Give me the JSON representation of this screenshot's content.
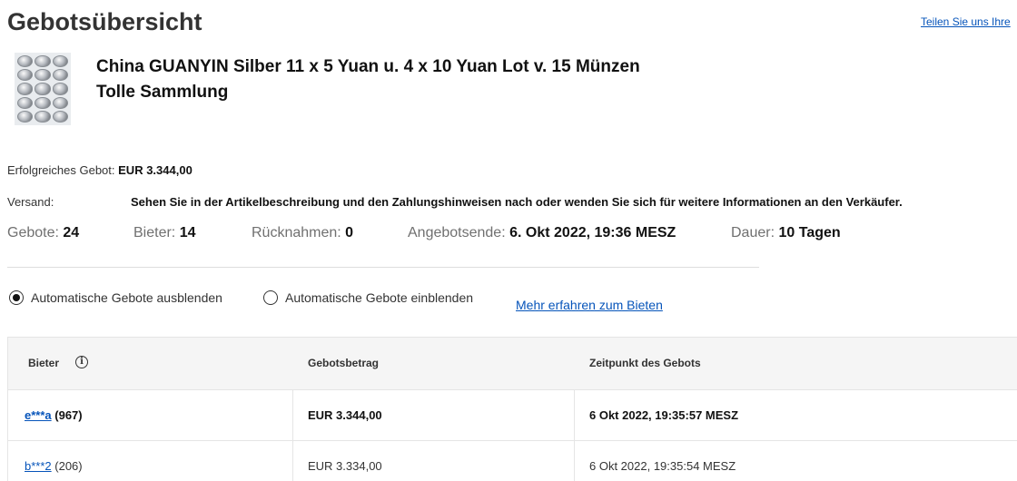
{
  "page": {
    "title": "Gebotsübersicht",
    "share_link": "Teilen Sie uns Ihre"
  },
  "item": {
    "title": "China GUANYIN Silber 11 x 5 Yuan u. 4 x 10 Yuan Lot v. 15 Münzen Tolle Sammlung"
  },
  "details": {
    "winning_bid_label": "Erfolgreiches Gebot:",
    "winning_bid_value": "EUR 3.344,00",
    "shipping_label": "Versand:",
    "shipping_value": "Sehen Sie in der Artikelbeschreibung und den Zahlungshinweisen nach oder wenden Sie sich für weitere Informationen an den Verkäufer."
  },
  "stats": {
    "bids_label": "Gebote:",
    "bids_value": "24",
    "bidders_label": "Bieter:",
    "bidders_value": "14",
    "retractions_label": "Rücknahmen:",
    "retractions_value": "0",
    "end_label": "Angebotsende:",
    "end_value": "6. Okt 2022, 19:36 MESZ",
    "duration_label": "Dauer:",
    "duration_value": "10 Tagen"
  },
  "options": {
    "hide_auto_label": "Automatische Gebote ausblenden",
    "hide_auto_selected": true,
    "show_auto_label": "Automatische Gebote einblenden",
    "show_auto_selected": false,
    "learn_more": "Mehr erfahren zum Bieten"
  },
  "table": {
    "headers": {
      "bidder": "Bieter",
      "amount": "Gebotsbetrag",
      "time": "Zeitpunkt des Gebots"
    },
    "rows": [
      {
        "bidder": "e***a",
        "feedback": "(967)",
        "amount": "EUR 3.344,00",
        "time": "6 Okt 2022, 19:35:57 MESZ",
        "bold": true
      },
      {
        "bidder": "b***2",
        "feedback": "(206)",
        "amount": "EUR 3.334,00",
        "time": "6 Okt 2022, 19:35:54 MESZ",
        "bold": false
      }
    ]
  },
  "icons": {
    "info": "info-icon",
    "radio_selected": "radio-selected-icon",
    "radio_unselected": "radio-unselected-icon"
  },
  "colors": {
    "link": "#0654ba",
    "header_bg": "#f5f5f5",
    "border": "#e5e5e5",
    "label_gray": "#707070"
  }
}
